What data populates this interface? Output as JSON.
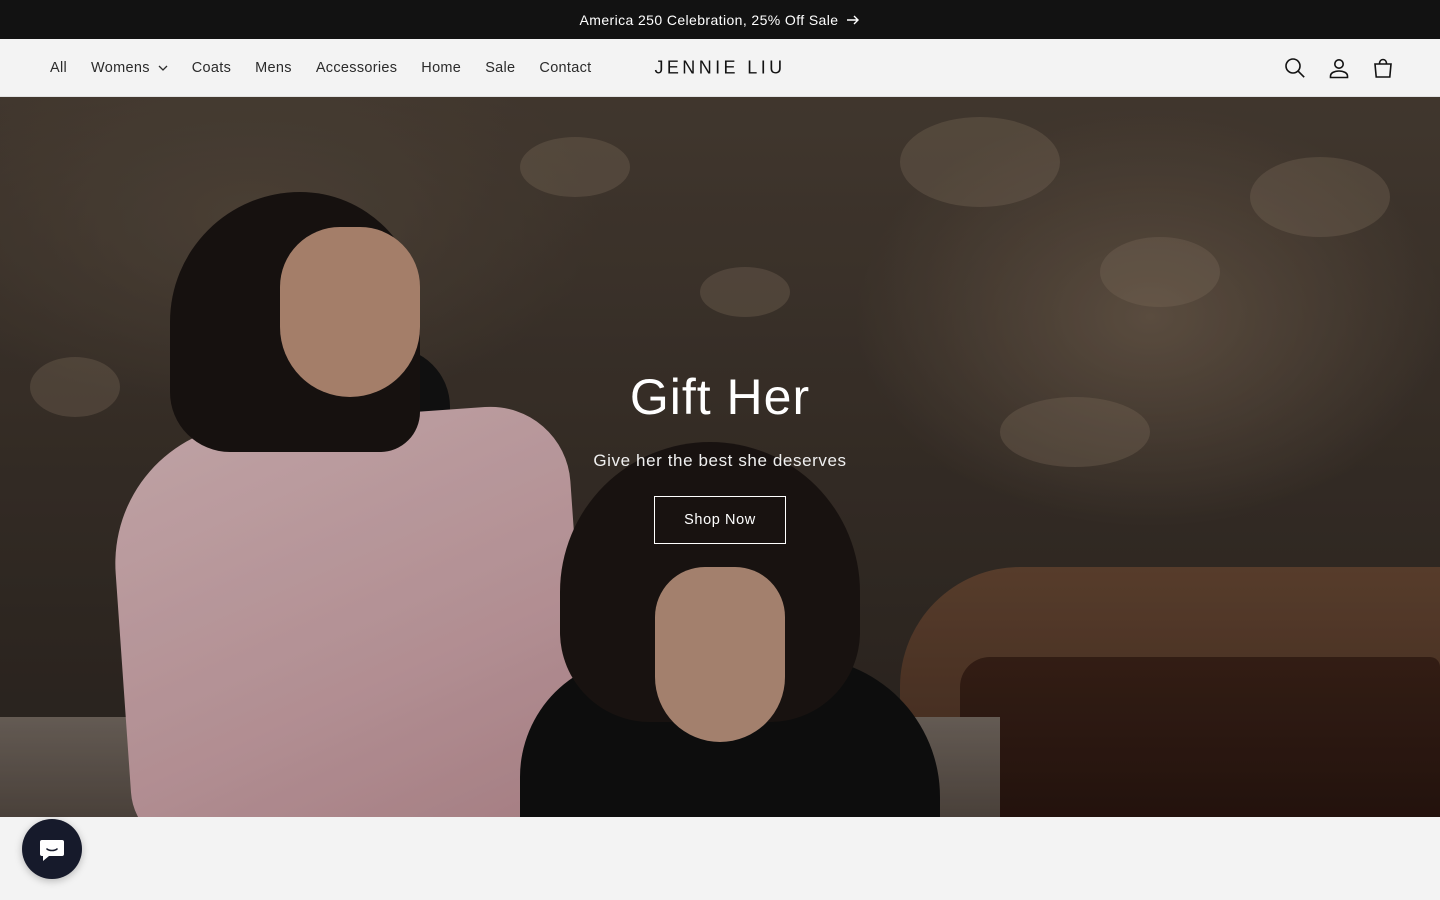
{
  "announcement": {
    "text": "America 250 Celebration, 25% Off Sale",
    "icon": "arrow-right-icon"
  },
  "header": {
    "logo": "JENNIE LIU",
    "nav": [
      {
        "label": "All"
      },
      {
        "label": "Womens",
        "has_dropdown": true
      },
      {
        "label": "Coats"
      },
      {
        "label": "Mens"
      },
      {
        "label": "Accessories"
      },
      {
        "label": "Home"
      },
      {
        "label": "Sale"
      },
      {
        "label": "Contact"
      }
    ],
    "icons": [
      "search-icon",
      "account-icon",
      "cart-icon"
    ]
  },
  "hero": {
    "title": "Gift Her",
    "subtitle": "Give her the best she deserves",
    "button_label": "Shop Now"
  },
  "chat": {
    "icon": "chat-icon"
  },
  "colors": {
    "announcement_bg": "#121212",
    "header_bg": "#f3f3f3",
    "chat_bg": "#161a2b"
  }
}
